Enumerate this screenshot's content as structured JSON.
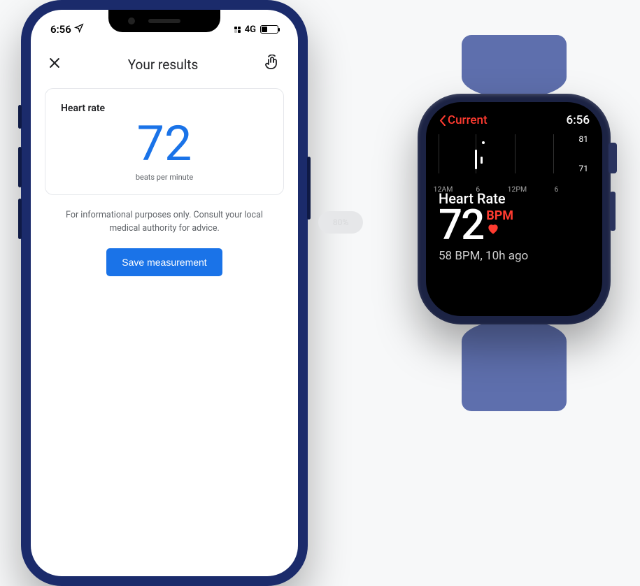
{
  "phone": {
    "status": {
      "time": "6:56",
      "network_type": "4G"
    },
    "header": {
      "title": "Your results"
    },
    "card": {
      "label": "Heart rate",
      "value": "72",
      "unit": "beats per minute"
    },
    "disclaimer": "For informational purposes only. Consult your local medical authority for advice.",
    "save_button": "Save measurement"
  },
  "float_pill": "80%",
  "watch": {
    "back_label": "Current",
    "time": "6:56",
    "chart": {
      "max_label": "81",
      "min_label": "71",
      "x_labels": [
        "12AM",
        "6",
        "12PM",
        "6"
      ]
    },
    "title": "Heart Rate",
    "value": "72",
    "bpm_label": "BPM",
    "subtitle": "58 BPM, 10h ago"
  },
  "chart_data": {
    "type": "line",
    "title": "Heart Rate",
    "x": [
      "12AM",
      "6",
      "12PM",
      "6"
    ],
    "ylim": [
      71,
      81
    ],
    "series": [
      {
        "name": "Heart Rate (BPM)",
        "values": [
          null,
          72,
          null,
          null
        ]
      }
    ],
    "annotations": {
      "current_value": 72,
      "history": "58 BPM, 10h ago"
    }
  }
}
